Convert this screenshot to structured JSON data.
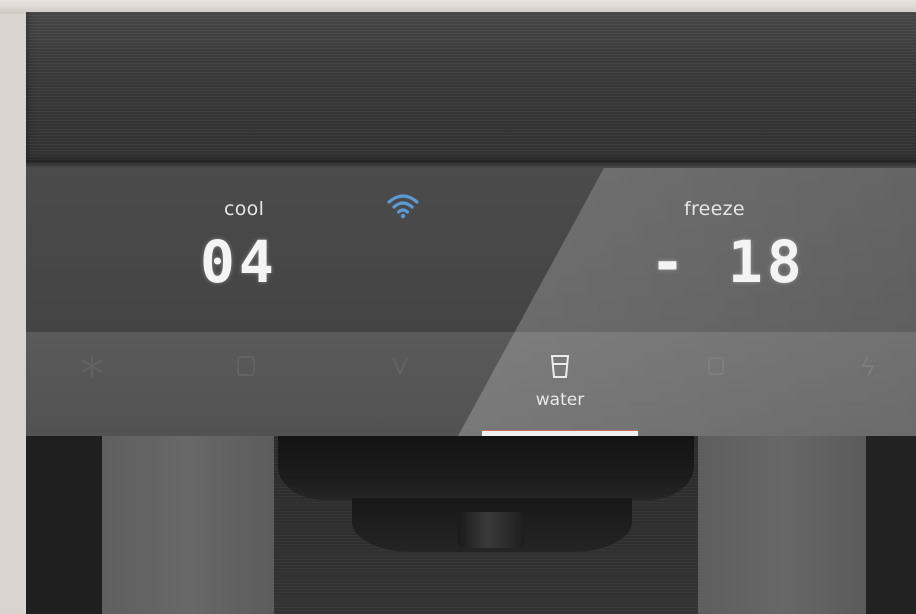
{
  "display": {
    "cool": {
      "label": "cool",
      "value": "04"
    },
    "freeze": {
      "label": "freeze",
      "value": "- 18"
    },
    "wifi_icon": "wifi-icon",
    "accent_color": "#5b9bd5"
  },
  "buttons": [
    {
      "label": "",
      "icon": "snowflake-icon",
      "state": "dim"
    },
    {
      "label": "",
      "icon": "ice-icon",
      "state": "dim"
    },
    {
      "label": "",
      "icon": "crushed-ice-icon",
      "state": "dim"
    },
    {
      "label": "water",
      "icon": "water-glass-icon",
      "state": "active"
    },
    {
      "label": "",
      "icon": "lock-icon",
      "state": "dim"
    },
    {
      "label": "",
      "icon": "light-icon",
      "state": "dim"
    }
  ]
}
